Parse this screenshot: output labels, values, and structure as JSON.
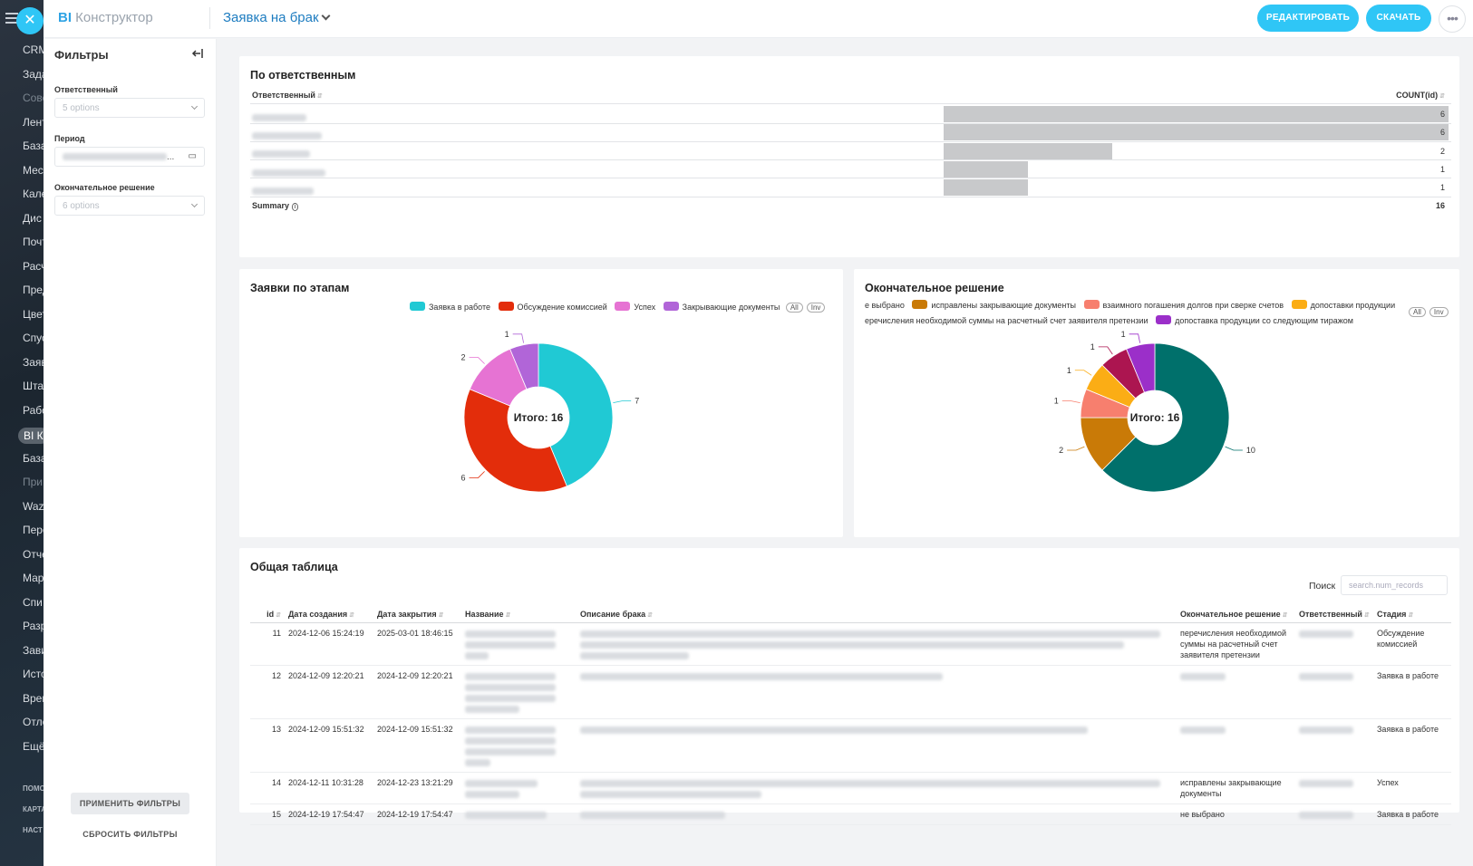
{
  "sidebar_nav": [
    "CRM",
    "Зада",
    "Сове",
    "Лент",
    "База",
    "Мес",
    "Кале",
    "Дис",
    "Почт",
    "Расч",
    "Пред",
    "Цвет",
    "Спус",
    "Заяв",
    "Штат",
    "Рабо",
    "BI К",
    "База",
    "При",
    "Waz",
    "Пере",
    "Отче",
    "Мар",
    "Спи",
    "Разр",
    "Зави",
    "Исто",
    "Врем",
    "Отло",
    "Ещё"
  ],
  "sidebar_nav_bottom": [
    "ПОМО",
    "КАРТА",
    "НАСТ"
  ],
  "topbar": {
    "brand_bi": "BI",
    "brand_name": "Конструктор",
    "dashboard_title": "Заявка на брак",
    "edit_button": "РЕДАКТИРОВАТЬ",
    "download_button": "СКАЧАТЬ",
    "more_icon": "•••"
  },
  "filters": {
    "title": "Фильтры",
    "collapse_icon": "|←",
    "responsible_label": "Ответственный",
    "responsible_value": "5 options",
    "period_label": "Период",
    "period_ellipsis": "...",
    "decision_label": "Окончательное решение",
    "decision_value": "6 options",
    "apply_button": "ПРИМЕНИТЬ ФИЛЬТРЫ",
    "reset_button": "СБРОСИТЬ ФИЛЬТРЫ"
  },
  "by_responsible": {
    "title": "По ответственным",
    "col_responsible": "Ответственный",
    "col_count": "COUNT(id)",
    "rows": [
      6,
      6,
      2,
      1,
      1
    ],
    "summary_label": "Summary",
    "summary_value": "16"
  },
  "stages_chart": {
    "title": "Заявки по этапам",
    "center_label": "Итого: 16",
    "pill_all": "All",
    "pill_inv": "Inv",
    "colors": {
      "in_work": "#20c9d4",
      "commission": "#e32d0b",
      "success": "#e673d3",
      "closing": "#b165d8"
    }
  },
  "decision_chart": {
    "title": "Окончательное решение",
    "center_label": "Итого: 16",
    "pill_all": "All",
    "pill_inv": "Inv",
    "colors": {
      "not_selected": "#00706b",
      "fixed_docs": "#c97a07",
      "mutual": "#f77f6e",
      "supply": "#fbad15",
      "transfer": "#ac1550",
      "supply_next": "#9b2fc9"
    }
  },
  "chart_data": [
    {
      "type": "pie",
      "center_label": "Итого: 16",
      "categories": [
        "Заявка в работе",
        "Обсуждение комиссией",
        "Успех",
        "Закрывающие документы"
      ],
      "values": [
        7,
        6,
        2,
        1
      ]
    },
    {
      "type": "pie",
      "center_label": "Итого: 16",
      "categories": [
        "не выбрано",
        "исправлены закрывающие документы",
        "взаимного погашения долгов при сверке счетов",
        "допоставки продукции",
        "перечисления необходимой суммы на расчетный счет заявителя претензии",
        "допоставка продукции со следующим тиражом"
      ],
      "legend_visible_text": [
        "е выбрано",
        "исправлены закрывающие документы",
        "взаимного погашения долгов при сверке счетов",
        "допоставки продукции",
        "еречисления необходимой суммы на расчетный счет заявителя претензии",
        "допоставка продукции со следующим тиражом"
      ],
      "values": [
        10,
        2,
        1,
        1,
        1,
        1
      ]
    }
  ],
  "general_table": {
    "title": "Общая таблица",
    "search_label": "Поиск",
    "search_placeholder": "search.num_records",
    "columns": [
      "id",
      "Дата создания",
      "Дата закрытия",
      "Название",
      "Описание брака",
      "Окончательное решение",
      "Ответственный",
      "Стадия"
    ],
    "rows": [
      {
        "id": "11",
        "created": "2024-12-06 15:24:19",
        "closed": "2025-03-01 18:46:15",
        "decision": "перечисления необходимой суммы на расчетный счет заявителя претензии",
        "stage": "Обсуждение комиссией"
      },
      {
        "id": "12",
        "created": "2024-12-09 12:20:21",
        "closed": "2024-12-09 12:20:21",
        "decision": "",
        "stage": "Заявка в работе"
      },
      {
        "id": "13",
        "created": "2024-12-09 15:51:32",
        "closed": "2024-12-09 15:51:32",
        "decision": "",
        "stage": "Заявка в работе"
      },
      {
        "id": "14",
        "created": "2024-12-11 10:31:28",
        "closed": "2024-12-23 13:21:29",
        "decision": "исправлены закрывающие документы",
        "stage": "Успех"
      },
      {
        "id": "15",
        "created": "2024-12-19 17:54:47",
        "closed": "2024-12-19 17:54:47",
        "decision": "не выбрано",
        "stage": "Заявка в работе"
      }
    ]
  }
}
